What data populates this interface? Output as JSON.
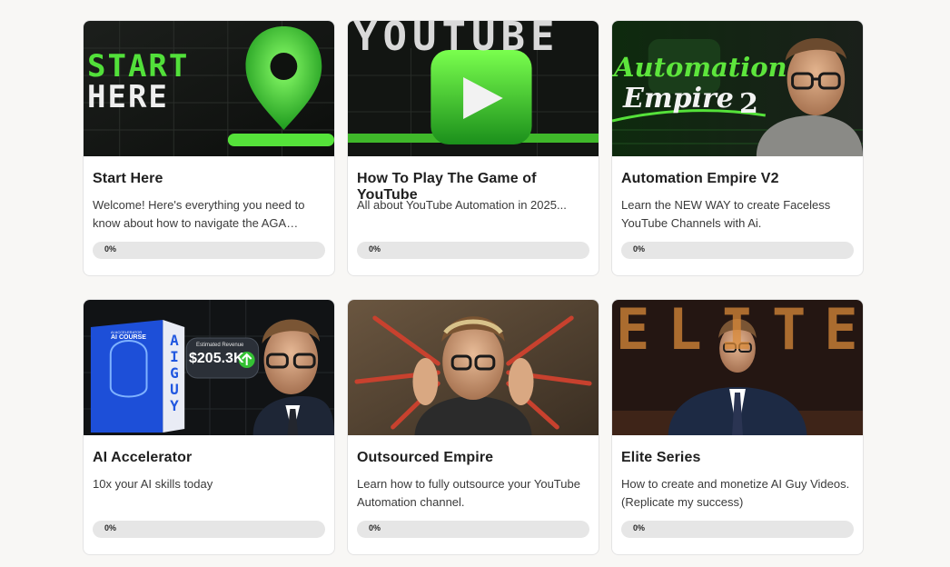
{
  "courses": [
    {
      "title": "Start Here",
      "description": "Welcome! Here's everything you need to know about how to navigate the AGA…",
      "progress": 0,
      "progress_label": "0%",
      "thumbnail": {
        "icon": "location-pin-icon",
        "text_line1": "START",
        "text_line2": "HERE"
      }
    },
    {
      "title": "How To Play The Game of YouTube",
      "description": "All about YouTube Automation in 2025...",
      "progress": 0,
      "progress_label": "0%",
      "thumbnail": {
        "icon": "play-button-icon",
        "banner_text": "YOUTUBE"
      }
    },
    {
      "title": "Automation Empire V2",
      "description": "Learn the NEW WAY to create Faceless YouTube Channels with Ai.",
      "progress": 0,
      "progress_label": "0%",
      "thumbnail": {
        "text_line1": "Automation",
        "text_line2": "Empire",
        "number": "2",
        "icon": "portrait-icon"
      }
    },
    {
      "title": "AI Accelerator",
      "description": "10x your AI skills today",
      "progress": 0,
      "progress_label": "0%",
      "thumbnail": {
        "box_small": "AI ACCELERATOR",
        "box_label": "AI COURSE",
        "box_side": "AI GUY",
        "revenue_caption": "Estimated Revenue",
        "revenue_value": "$205.3K",
        "icon": "arrow-up-icon"
      }
    },
    {
      "title": "Outsourced Empire",
      "description": "Learn how to fully outsource your YouTube Automation channel.",
      "progress": 0,
      "progress_label": "0%",
      "thumbnail": {
        "icon": "portrait-icon"
      }
    },
    {
      "title": "Elite Series",
      "description": "How to create and monetize AI Guy Videos. (Replicate my success)",
      "progress": 0,
      "progress_label": "0%",
      "thumbnail": {
        "banner_text": "ELITE",
        "icon": "portrait-icon"
      }
    }
  ],
  "colors": {
    "accent_green": "#3fd13f",
    "card_border": "#e4e4e4",
    "progress_track": "#e6e6e6",
    "page_background": "#f8f7f5"
  }
}
